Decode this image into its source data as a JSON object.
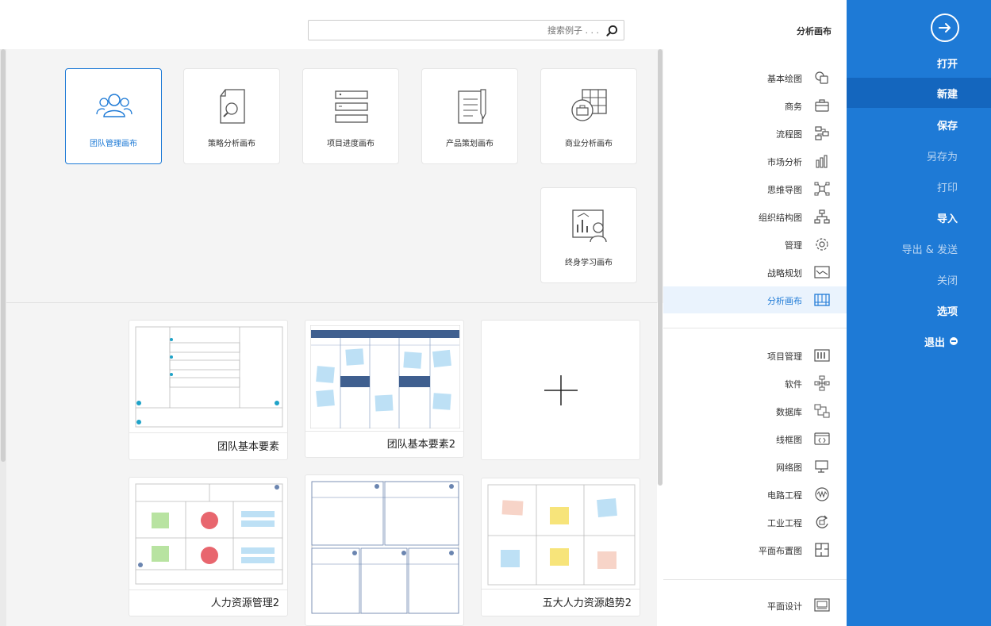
{
  "menu": {
    "items": [
      {
        "label": "打开",
        "style": "bold"
      },
      {
        "label": "新建",
        "style": "bold active"
      },
      {
        "label": "保存",
        "style": "bold"
      },
      {
        "label": "另存为",
        "style": "dim"
      },
      {
        "label": "打印",
        "style": "dim"
      },
      {
        "label": "导入",
        "style": "bold"
      },
      {
        "label": "导出 & 发送",
        "style": "dim"
      },
      {
        "label": "关闭",
        "style": "dim"
      },
      {
        "label": "选项",
        "style": "bold"
      },
      {
        "label": "退出",
        "style": "bold"
      }
    ]
  },
  "header": {
    "title": "分析画布",
    "search_placeholder": "搜索例子 . . ."
  },
  "categories": {
    "group1": [
      {
        "label": "基本绘图",
        "icon": "shapes-icon"
      },
      {
        "label": "商务",
        "icon": "briefcase-icon"
      },
      {
        "label": "流程图",
        "icon": "flowchart-icon"
      },
      {
        "label": "市场分析",
        "icon": "bar-chart-icon"
      },
      {
        "label": "思维导图",
        "icon": "mindmap-icon"
      },
      {
        "label": "组织结构图",
        "icon": "org-chart-icon"
      },
      {
        "label": "管理",
        "icon": "gear-icon"
      },
      {
        "label": "战略规划",
        "icon": "strategy-icon"
      },
      {
        "label": "分析画布",
        "icon": "canvas-icon",
        "active": true
      }
    ],
    "group2": [
      {
        "label": "项目管理",
        "icon": "gantt-icon"
      },
      {
        "label": "软件",
        "icon": "software-icon"
      },
      {
        "label": "数据库",
        "icon": "database-icon"
      },
      {
        "label": "线框图",
        "icon": "wireframe-icon"
      },
      {
        "label": "网络图",
        "icon": "network-icon"
      },
      {
        "label": "电路工程",
        "icon": "circuit-icon"
      },
      {
        "label": "工业工程",
        "icon": "industrial-icon"
      },
      {
        "label": "平面布置图",
        "icon": "floorplan-icon"
      }
    ],
    "group3": [
      {
        "label": "平面设计",
        "icon": "graphic-design-icon"
      }
    ]
  },
  "subcategories": [
    {
      "label": "商业分析画布",
      "icon": "business-canvas-icon"
    },
    {
      "label": "产品策划画布",
      "icon": "product-plan-icon"
    },
    {
      "label": "项目进度画布",
      "icon": "project-progress-icon"
    },
    {
      "label": "策略分析画布",
      "icon": "strategy-analysis-icon"
    },
    {
      "label": "团队管理画布",
      "icon": "team-icon",
      "active": true
    },
    {
      "label": "终身学习画布",
      "icon": "lifelong-learning-icon"
    }
  ],
  "templates": [
    {
      "label": "",
      "kind": "new"
    },
    {
      "label": "团队基本要素2"
    },
    {
      "label": "团队基本要素"
    },
    {
      "label": "五大人力资源趋势2"
    },
    {
      "label": ""
    },
    {
      "label": "人力资源管理2"
    }
  ],
  "colors": {
    "accent": "#1E7AD6",
    "accent_dark": "#1466BE",
    "panel_bg": "#f4f4f4",
    "sticky_blue": "#BDE0F5",
    "sticky_yellow": "#F7E47A",
    "sticky_pink": "#F7D4C8",
    "sticky_green": "#B8E3A1",
    "sticky_red": "#E8666E",
    "header_navy": "#3F5F8F"
  }
}
